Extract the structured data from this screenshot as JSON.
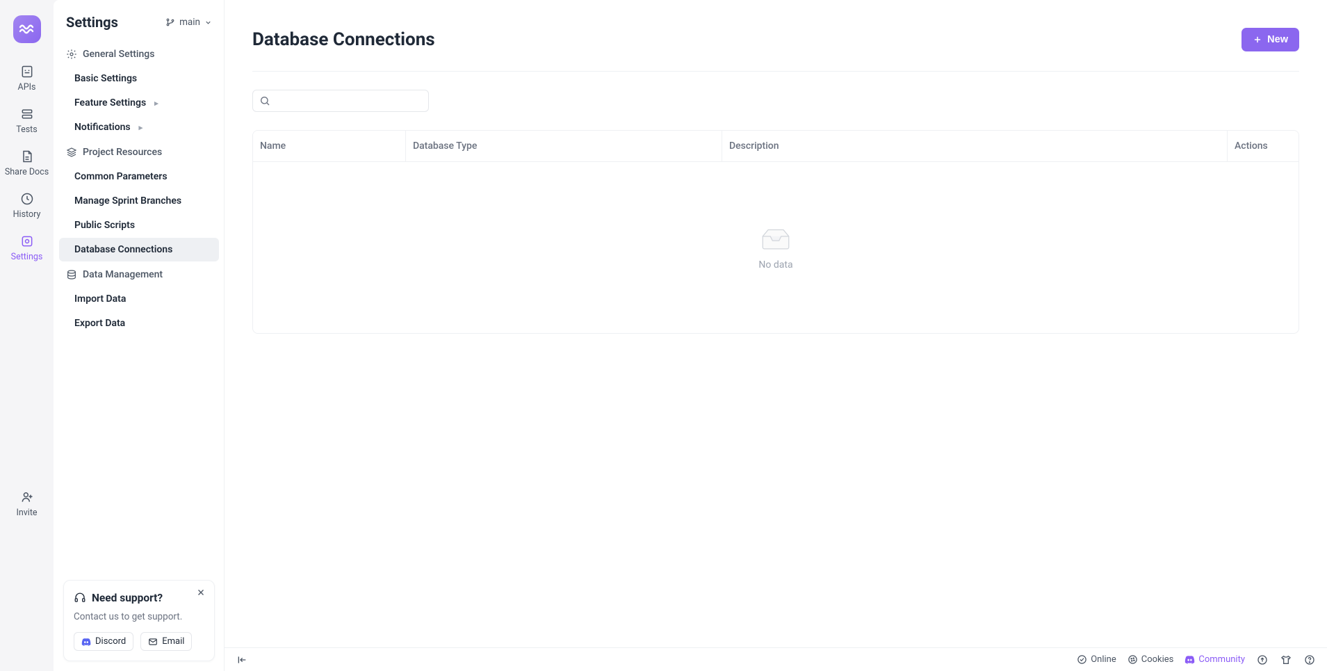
{
  "rail": {
    "items": [
      {
        "label": "APIs"
      },
      {
        "label": "Tests"
      },
      {
        "label": "Share Docs"
      },
      {
        "label": "History"
      },
      {
        "label": "Settings"
      },
      {
        "label": "Invite"
      }
    ]
  },
  "panel": {
    "title": "Settings",
    "branch": "main",
    "sections": {
      "general": {
        "label": "General Settings",
        "items": [
          "Basic Settings",
          "Feature Settings",
          "Notifications"
        ]
      },
      "project": {
        "label": "Project Resources",
        "items": [
          "Common Parameters",
          "Manage Sprint Branches",
          "Public Scripts",
          "Database Connections"
        ]
      },
      "data": {
        "label": "Data Management",
        "items": [
          "Import Data",
          "Export Data"
        ]
      }
    }
  },
  "support": {
    "title": "Need support?",
    "subtitle": "Contact us to get support.",
    "discord": "Discord",
    "email": "Email"
  },
  "page": {
    "title": "Database Connections",
    "new_button": "New",
    "search_placeholder": ""
  },
  "table": {
    "columns": [
      "Name",
      "Database Type",
      "Description",
      "Actions"
    ],
    "empty_text": "No data"
  },
  "footer": {
    "online": "Online",
    "cookies": "Cookies",
    "community": "Community"
  }
}
